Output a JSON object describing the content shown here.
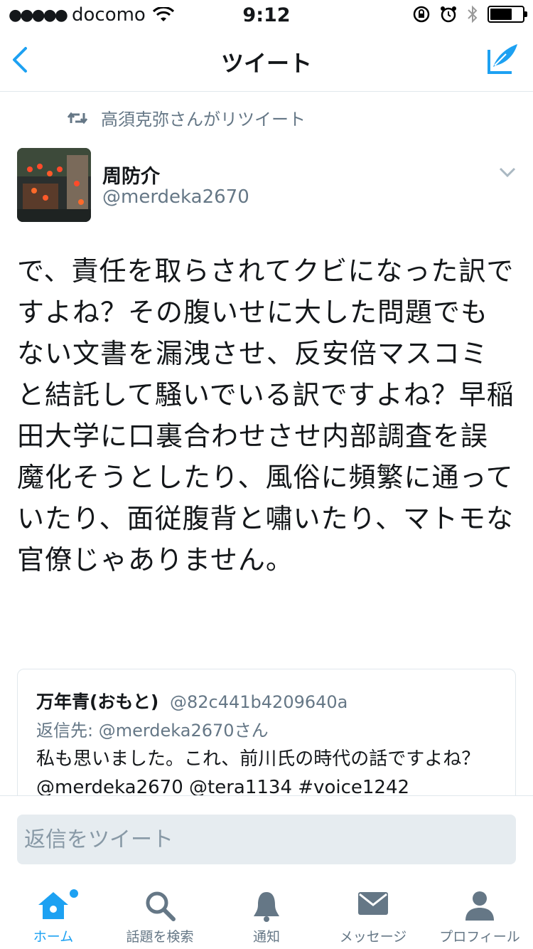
{
  "status_bar": {
    "carrier": "docomo",
    "time": "9:12",
    "signal_icon": "signal-dots-icon",
    "wifi_icon": "wifi-icon",
    "icons_right": [
      "rotation-lock-icon",
      "alarm-icon",
      "bluetooth-icon",
      "battery-icon"
    ]
  },
  "nav": {
    "title": "ツイート",
    "back_icon": "chevron-left-icon",
    "compose_icon": "compose-tweet-icon"
  },
  "retweet": {
    "icon": "retweet-icon",
    "text": "高須克弥さんがリツイート"
  },
  "tweet": {
    "author_name": "周防介",
    "author_handle": "@merdeka2670",
    "body": "で、責任を取らされてクビになった訳ですよね？その腹いせに大した問題でもない文書を漏洩させ、反安倍マスコミと結託して騒いでいる訳ですよね？早稲田大学に口裏合わせさせ内部調査を誤魔化そうとしたり、風俗に頻繁に通っていたり、面従腹背と嘯いたり、マトモな官僚じゃありません。"
  },
  "quote": {
    "name": "万年青(おもと)",
    "handle": "@82c441b4209640a",
    "reply_to": "返信先: @merdeka2670さん",
    "text": "私も思いました。これ、前川氏の時代の話ですよね？@merdeka2670 @tera1134 #voice1242"
  },
  "reply": {
    "placeholder": "返信をツイート"
  },
  "tabs": [
    {
      "label": "ホーム",
      "icon": "home-icon",
      "active": true
    },
    {
      "label": "話題を検索",
      "icon": "search-icon",
      "active": false
    },
    {
      "label": "通知",
      "icon": "bell-icon",
      "active": false
    },
    {
      "label": "メッセージ",
      "icon": "envelope-icon",
      "active": false
    },
    {
      "label": "プロフィール",
      "icon": "person-icon",
      "active": false
    }
  ],
  "colors": {
    "accent": "#1da1f2",
    "secondary_text": "#657786",
    "border": "#e1e8ed"
  }
}
